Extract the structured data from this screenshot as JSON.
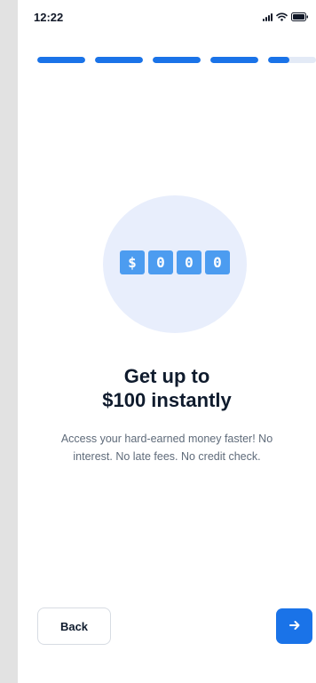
{
  "status_bar": {
    "time": "12:22",
    "icons": [
      "signal-icon",
      "wifi-icon",
      "battery-icon"
    ]
  },
  "progress": {
    "steps_total": 5,
    "segments_fill": [
      1,
      1,
      1,
      1,
      0.45
    ],
    "accent_color": "#1a73e8"
  },
  "hero": {
    "digits": [
      "$",
      "0",
      "0",
      "0"
    ]
  },
  "content": {
    "title_line1": "Get up to",
    "title_line2": "$100 instantly",
    "subtitle_line1": "Access your hard-earned money faster! No",
    "subtitle_line2": "interest. No late fees. No credit check."
  },
  "footer": {
    "back_label": "Back",
    "next_icon": "arrow-right-icon"
  }
}
